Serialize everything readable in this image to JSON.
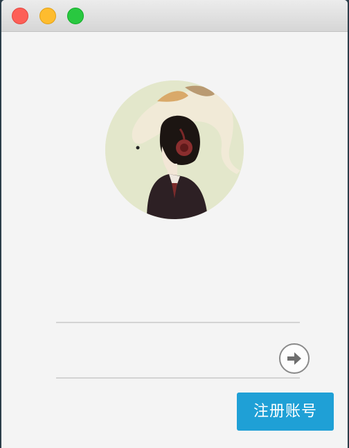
{
  "window": {
    "controls": [
      "close",
      "minimize",
      "zoom"
    ]
  },
  "avatar": {
    "icon": "user-avatar-illustration"
  },
  "login_form": {
    "account_value": "",
    "password_value": "",
    "submit_icon": "arrow-right-circle-icon",
    "register_label": "注册账号"
  },
  "colors": {
    "register_button": "#1fa0d6",
    "background": "#f4f4f4",
    "close": "#fd5f57",
    "minimize": "#febc2e",
    "zoom": "#29c840"
  }
}
